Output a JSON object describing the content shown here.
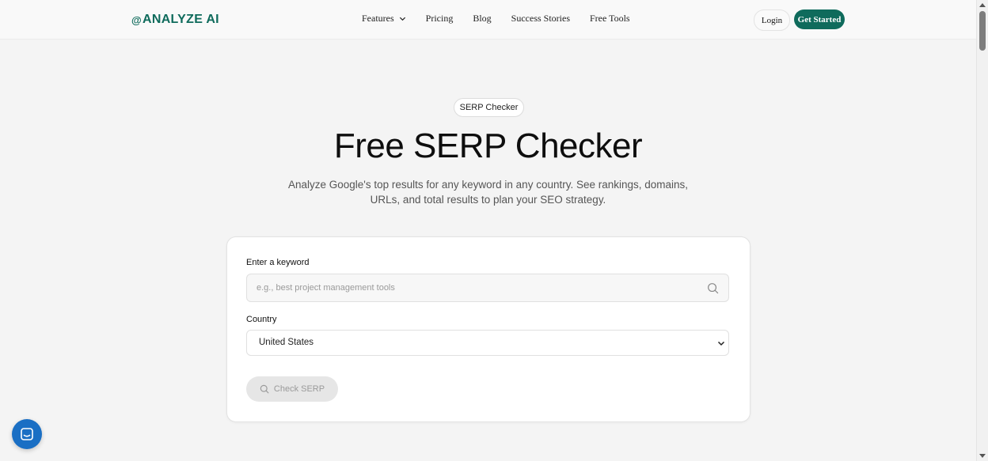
{
  "nav": {
    "logo_mark": "@",
    "logo_text": "ANALYZE AI",
    "links": [
      "Features",
      "Pricing",
      "Blog",
      "Success Stories",
      "Free Tools"
    ],
    "login": "Login",
    "get_started": "Get Started"
  },
  "hero": {
    "pill": "SERP Checker",
    "title": "Free SERP Checker",
    "subtitle": "Analyze Google's top results for any keyword in any country. See rankings, domains, URLs, and total results to plan your SEO strategy."
  },
  "form": {
    "keyword_label": "Enter a keyword",
    "keyword_placeholder": "e.g., best project management tools",
    "country_label": "Country",
    "country_value": "United States",
    "submit_label": "Check SERP"
  },
  "colors": {
    "brand": "#0f6b5c",
    "chat": "#1a6fc4"
  },
  "icons": {
    "search": "search-icon",
    "chevron": "chevron-down-icon",
    "chat": "chat-icon"
  }
}
